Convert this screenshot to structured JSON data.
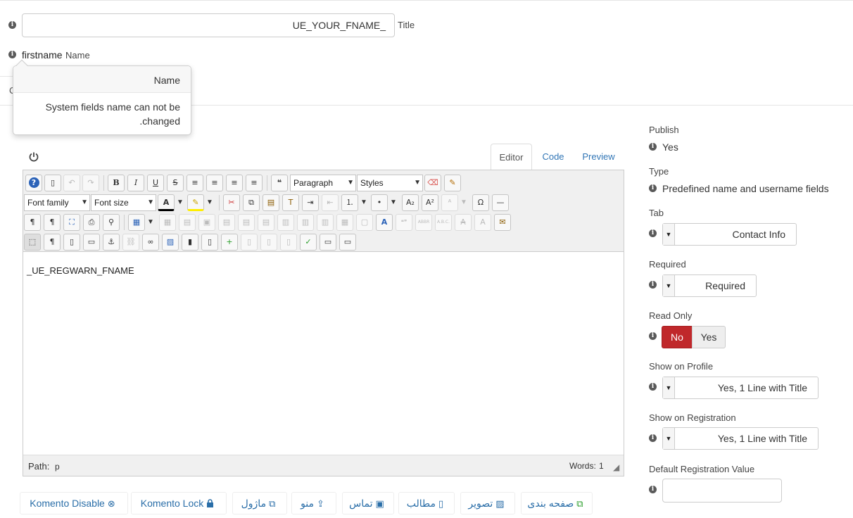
{
  "form": {
    "title_value": "UE_YOUR_FNAME_",
    "title_label": "Title",
    "name_value": "firstname",
    "name_label": "Name",
    "tab_fragment": "C",
    "tooltip": {
      "heading": "Name",
      "body": "System fields name can not be changed."
    }
  },
  "editor": {
    "tabs": [
      "Editor",
      "Code",
      "Preview"
    ],
    "active_tab": "Editor",
    "toolbar": {
      "format_select": "Paragraph",
      "styles_select": "Styles",
      "font_family_select": "Font family",
      "font_size_select": "Font size"
    },
    "content": "_UE_REGWARN_FNAME",
    "path_label": "Path:",
    "path_value": "p",
    "words_label": "Words:",
    "words_value": "1"
  },
  "settings": {
    "publish": {
      "label": "Publish",
      "value": "Yes"
    },
    "type": {
      "label": "Type",
      "value": "Predefined name and username fields"
    },
    "tab": {
      "label": "Tab",
      "value": "Contact Info"
    },
    "required": {
      "label": "Required",
      "value": "Required"
    },
    "read_only": {
      "label": "Read Only",
      "options": [
        "No",
        "Yes"
      ],
      "selected": "No"
    },
    "show_on_profile": {
      "label": "Show on Profile",
      "value": "Yes, 1 Line with Title"
    },
    "show_on_registration": {
      "label": "Show on Registration",
      "value": "Yes, 1 Line with Title"
    },
    "default_registration": {
      "label": "Default Registration Value",
      "value": ""
    }
  },
  "extension_buttons": [
    {
      "label": "Komento Disable",
      "icon": "circle-x-icon"
    },
    {
      "label": "Komento Lock",
      "icon": "lock-icon"
    },
    {
      "label": "ماژول",
      "icon": "copy-icon"
    },
    {
      "label": "منو",
      "icon": "share-icon"
    },
    {
      "label": "تماس",
      "icon": "contact-icon"
    },
    {
      "label": "مطالب",
      "icon": "file-add-icon"
    },
    {
      "label": "تصویر",
      "icon": "picture-icon"
    },
    {
      "label": "صفحه بندی",
      "icon": "copy-icon"
    }
  ],
  "colors": {
    "accent": "#3176b6",
    "toggle_no": "#c0282b",
    "toolbar_bg": "#f0f0f0"
  }
}
